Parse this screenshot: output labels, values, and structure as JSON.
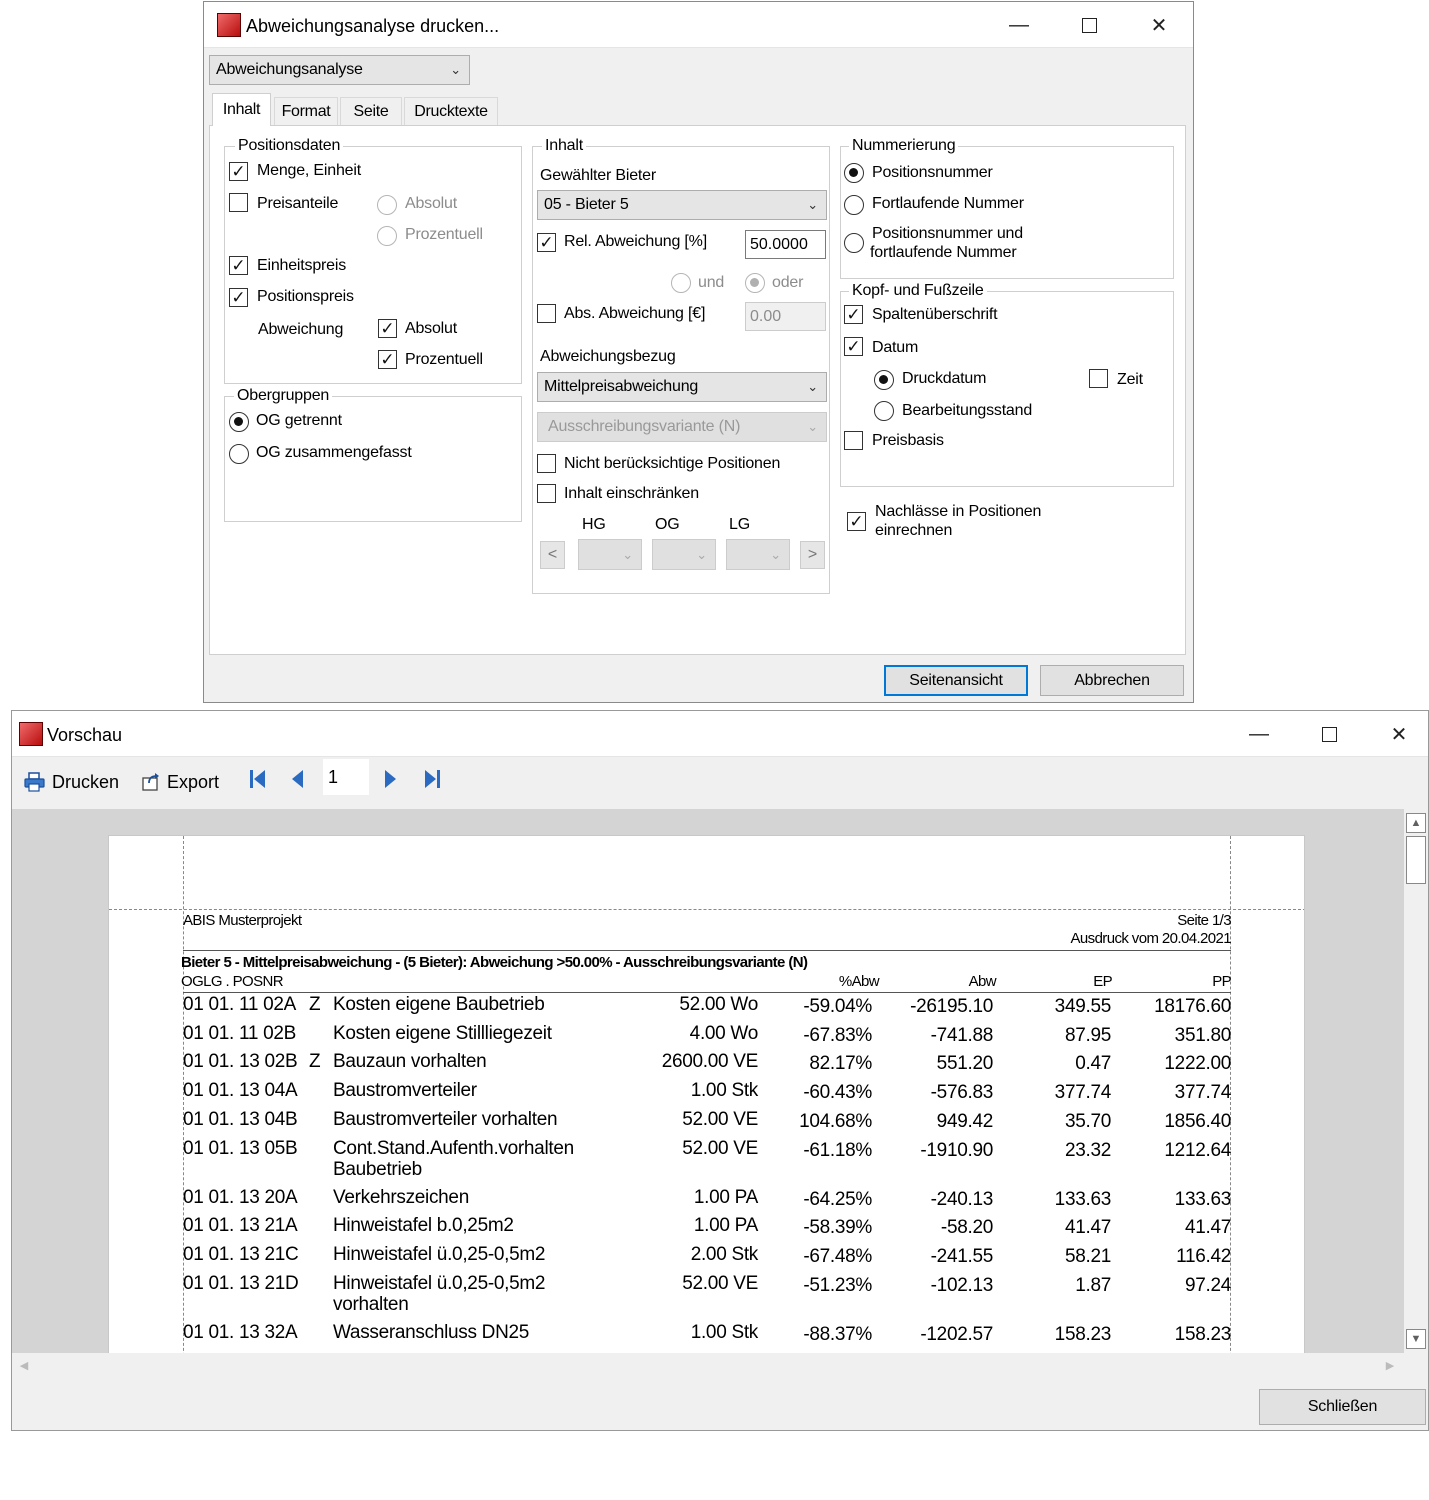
{
  "dialog": {
    "title": "Abweichungsanalyse drucken...",
    "report_select": "Abweichungsanalyse",
    "tabs": [
      "Inhalt",
      "Format",
      "Seite",
      "Drucktexte"
    ],
    "positionsdaten": {
      "title": "Positionsdaten",
      "menge_einheit": "Menge, Einheit",
      "preisanteile": "Preisanteile",
      "absolut": "Absolut",
      "prozentuell": "Prozentuell",
      "einheitspreis": "Einheitspreis",
      "positionspreis": "Positionspreis",
      "abweichung": "Abweichung",
      "abw_absolut": "Absolut",
      "abw_prozentuell": "Prozentuell"
    },
    "obergruppen": {
      "title": "Obergruppen",
      "og_getrennt": "OG getrennt",
      "og_zusammen": "OG zusammengefasst"
    },
    "inhalt": {
      "title": "Inhalt",
      "gewaehlter_bieter_label": "Gewählter Bieter",
      "bieter_value": "05 - Bieter 5",
      "rel_abweichung": "Rel. Abweichung [%]",
      "rel_value": "50.0000",
      "und": "und",
      "oder": "oder",
      "abs_abweichung": "Abs. Abweichung [€]",
      "abs_value": "0.00",
      "abweichungsbezug_label": "Abweichungsbezug",
      "bezug_value": "Mittelpreisabweichung",
      "variante_value": "Ausschreibungsvariante (N)",
      "nicht_beruecksichtige": "Nicht berücksichtige Positionen",
      "inhalt_einschraenken": "Inhalt einschränken",
      "hg": "HG",
      "og": "OG",
      "lg": "LG",
      "prev": "<",
      "next": ">"
    },
    "nummerierung": {
      "title": "Nummerierung",
      "positionsnummer": "Positionsnummer",
      "fortlaufende": "Fortlaufende Nummer",
      "both_line1": "Positionsnummer und",
      "both_line2": "fortlaufende Nummer"
    },
    "kopf_fuss": {
      "title": "Kopf- und Fußzeile",
      "spaltenueberschrift": "Spaltenüberschrift",
      "datum": "Datum",
      "druckdatum": "Druckdatum",
      "zeit": "Zeit",
      "bearbeitungsstand": "Bearbeitungsstand",
      "preisbasis": "Preisbasis"
    },
    "nachlaesse_line1": "Nachlässe in Positionen",
    "nachlaesse_line2": "einrechnen",
    "seitenansicht": "Seitenansicht",
    "abbrechen": "Abbrechen"
  },
  "preview": {
    "title": "Vorschau",
    "drucken": "Drucken",
    "export": "Export",
    "page_number": "1",
    "schliessen": "Schließen",
    "report": {
      "project": "ABIS Musterprojekt",
      "seite": "Seite 1/3",
      "ausdruck": "Ausdruck vom 20.04.2021",
      "subtitle": "Bieter 5 - Mittelpreisabweichung - (5 Bieter): Abweichung >50.00% - Ausschreibungsvariante (N)",
      "col_pos": "OGLG . POSNR",
      "col_abw_pct": "%Abw",
      "col_abw": "Abw",
      "col_ep": "EP",
      "col_pp": "PP",
      "rows": [
        {
          "pos": "01 01. 11 02A",
          "flag": "Z",
          "text": "Kosten eigene Baubetrieb",
          "text2": "",
          "menge": "52.00 Wo",
          "pct": "-59.04%",
          "abw": "-26195.10",
          "ep": "349.55",
          "pp": "18176.60"
        },
        {
          "pos": "01 01. 11 02B",
          "flag": "",
          "text": "Kosten eigene Stillliegezeit",
          "text2": "",
          "menge": "4.00 Wo",
          "pct": "-67.83%",
          "abw": "-741.88",
          "ep": "87.95",
          "pp": "351.80"
        },
        {
          "pos": "01 01. 13 02B",
          "flag": "Z",
          "text": "Bauzaun vorhalten",
          "text2": "",
          "menge": "2600.00 VE",
          "pct": "82.17%",
          "abw": "551.20",
          "ep": "0.47",
          "pp": "1222.00"
        },
        {
          "pos": "01 01. 13 04A",
          "flag": "",
          "text": "Baustromverteiler",
          "text2": "",
          "menge": "1.00 Stk",
          "pct": "-60.43%",
          "abw": "-576.83",
          "ep": "377.74",
          "pp": "377.74"
        },
        {
          "pos": "01 01. 13 04B",
          "flag": "",
          "text": "Baustromverteiler vorhalten",
          "text2": "",
          "menge": "52.00 VE",
          "pct": "104.68%",
          "abw": "949.42",
          "ep": "35.70",
          "pp": "1856.40"
        },
        {
          "pos": "01 01. 13 05B",
          "flag": "",
          "text": "Cont.Stand.Aufenth.vorhalten",
          "text2": "Baubetrieb",
          "menge": "52.00 VE",
          "pct": "-61.18%",
          "abw": "-1910.90",
          "ep": "23.32",
          "pp": "1212.64"
        },
        {
          "pos": "01 01. 13 20A",
          "flag": "",
          "text": "Verkehrszeichen",
          "text2": "",
          "menge": "1.00 PA",
          "pct": "-64.25%",
          "abw": "-240.13",
          "ep": "133.63",
          "pp": "133.63"
        },
        {
          "pos": "01 01. 13 21A",
          "flag": "",
          "text": "Hinweistafel b.0,25m2",
          "text2": "",
          "menge": "1.00 PA",
          "pct": "-58.39%",
          "abw": "-58.20",
          "ep": "41.47",
          "pp": "41.47"
        },
        {
          "pos": "01 01. 13 21C",
          "flag": "",
          "text": "Hinweistafel ü.0,25-0,5m2",
          "text2": "",
          "menge": "2.00 Stk",
          "pct": "-67.48%",
          "abw": "-241.55",
          "ep": "58.21",
          "pp": "116.42"
        },
        {
          "pos": "01 01. 13 21D",
          "flag": "",
          "text": "Hinweistafel ü.0,25-0,5m2",
          "text2": "vorhalten",
          "menge": "52.00 VE",
          "pct": "-51.23%",
          "abw": "-102.13",
          "ep": "1.87",
          "pp": "97.24"
        },
        {
          "pos": "01 01. 13 32A",
          "flag": "",
          "text": "Wasseranschluss DN25",
          "text2": "",
          "menge": "1.00 Stk",
          "pct": "-88.37%",
          "abw": "-1202.57",
          "ep": "158.23",
          "pp": "158.23"
        }
      ]
    }
  }
}
